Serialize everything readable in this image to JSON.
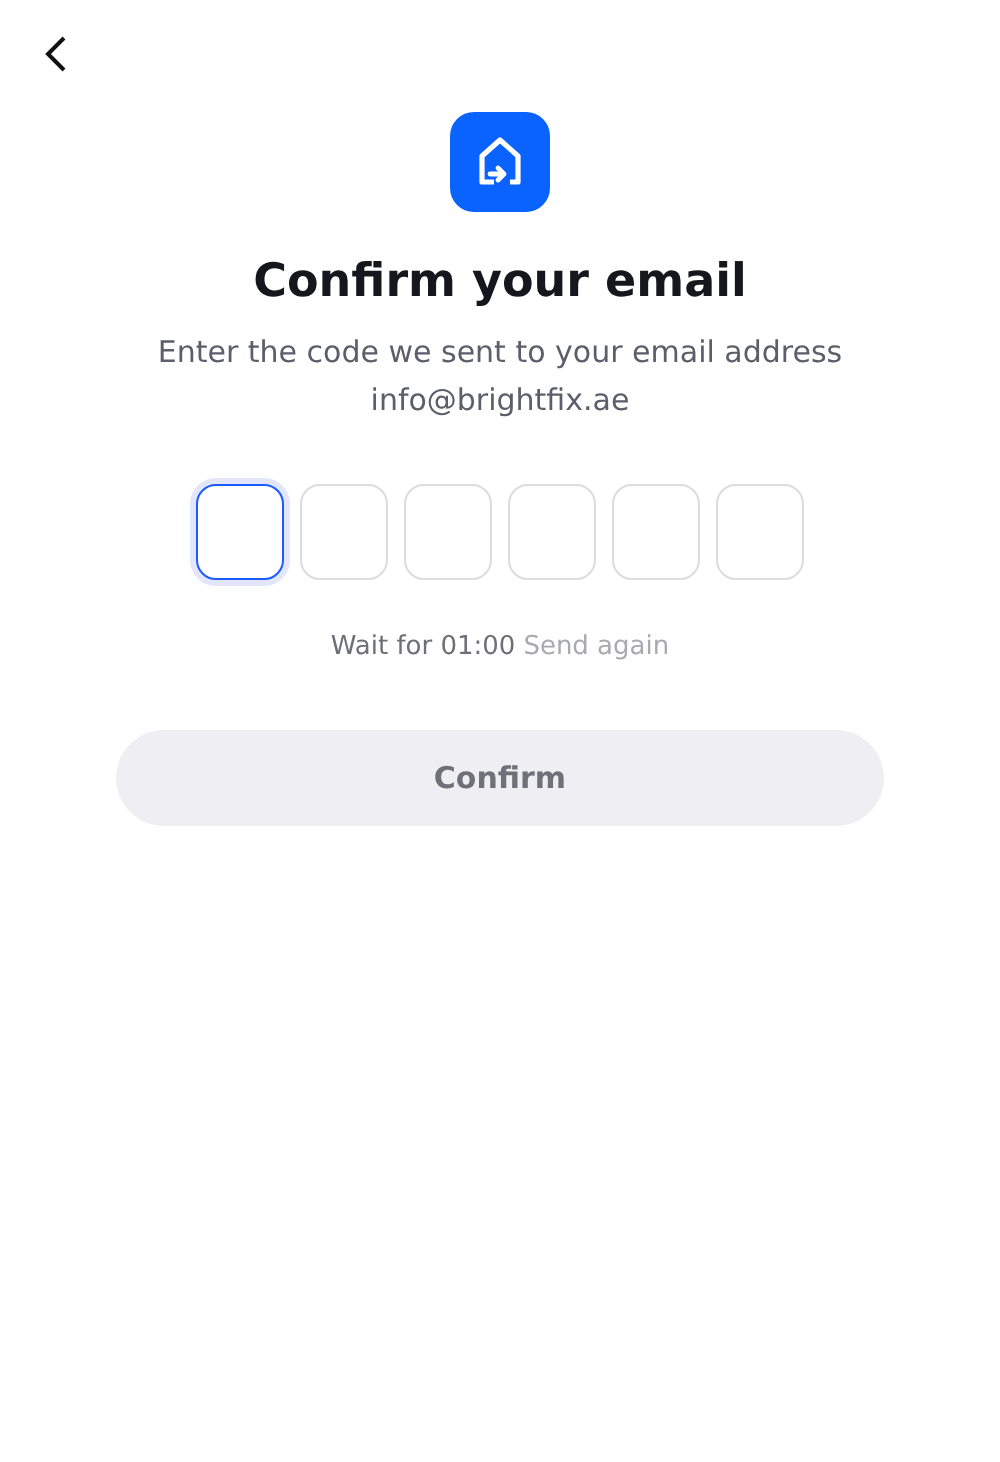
{
  "title": "Confirm your email",
  "subtitle": "Enter the code we sent to your email address",
  "email": "info@brightfix.ae",
  "code_fields": [
    {
      "selected": true
    },
    {
      "selected": false
    },
    {
      "selected": false
    },
    {
      "selected": false
    },
    {
      "selected": false
    },
    {
      "selected": false
    }
  ],
  "timer": {
    "text": "Wait for 01:00",
    "link": "Send again",
    "disabled": true
  },
  "confirm_button": {
    "label": "Confirm",
    "disabled": true
  }
}
